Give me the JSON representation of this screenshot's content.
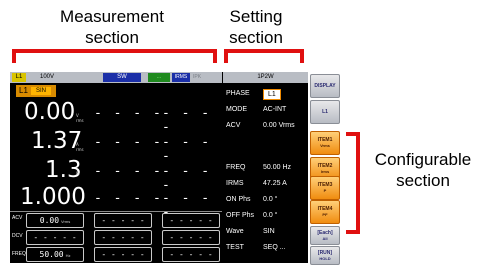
{
  "callouts": {
    "measurement": "Measurement\nsection",
    "setting": "Setting\nsection",
    "configurable": "Configurable\nsection"
  },
  "colors": {
    "bracket": "#e01010",
    "screen_bg": "#000000",
    "accent_orange": "#f08c10"
  },
  "topbar": {
    "channel": "L1",
    "voltage_range": "100V",
    "mode": "SW",
    "status1": "...",
    "status2": "IRMS",
    "status3": "IPK"
  },
  "phase_tab": {
    "label": "L1",
    "mode": "SIN"
  },
  "measurements": [
    {
      "value": "0.00",
      "unit": "V rms"
    },
    {
      "value": "1.37",
      "unit": "A rms"
    },
    {
      "value": "1.3",
      "unit": "W"
    },
    {
      "value": "1.000",
      "unit": ""
    }
  ],
  "dashes": "- - - -",
  "bottom_rows": [
    {
      "label": "ACV",
      "value": "0.00",
      "unit": "Vrms",
      "other": "- - - - -"
    },
    {
      "label": "DCV",
      "value": "- - - - -",
      "unit": "",
      "other": "- - - - -"
    },
    {
      "label": "FREQ",
      "value": "50.00",
      "unit": "Hz",
      "other": "- - - - -"
    }
  ],
  "setting": {
    "header": "1P2W",
    "rows": [
      {
        "key": "PHASE",
        "value": "L1"
      },
      {
        "key": "MODE",
        "value": "AC-INT"
      },
      {
        "key": "ACV",
        "value": "0.00 Vrms"
      },
      {
        "key": "FREQ",
        "value": "50.00 Hz"
      },
      {
        "key": "IRMS",
        "value": "47.25 A"
      },
      {
        "key": "ON Phs",
        "value": "0.0 °"
      },
      {
        "key": "OFF Phs",
        "value": "0.0 °"
      },
      {
        "key": "Wave",
        "value": "SIN"
      },
      {
        "key": "TEST",
        "value": "SEQ ..."
      }
    ]
  },
  "softkeys": [
    {
      "label": "DISPLAY",
      "sub": ""
    },
    {
      "label": "L1",
      "sub": ""
    },
    {
      "label": "ITEM1",
      "sub": "Vrms"
    },
    {
      "label": "ITEM2",
      "sub": "Irms"
    },
    {
      "label": "ITEM3",
      "sub": "P"
    },
    {
      "label": "ITEM4",
      "sub": "PF"
    },
    {
      "label": "[Each]",
      "sub": "All"
    },
    {
      "label": "[RUN]",
      "sub": "HOLD"
    }
  ]
}
